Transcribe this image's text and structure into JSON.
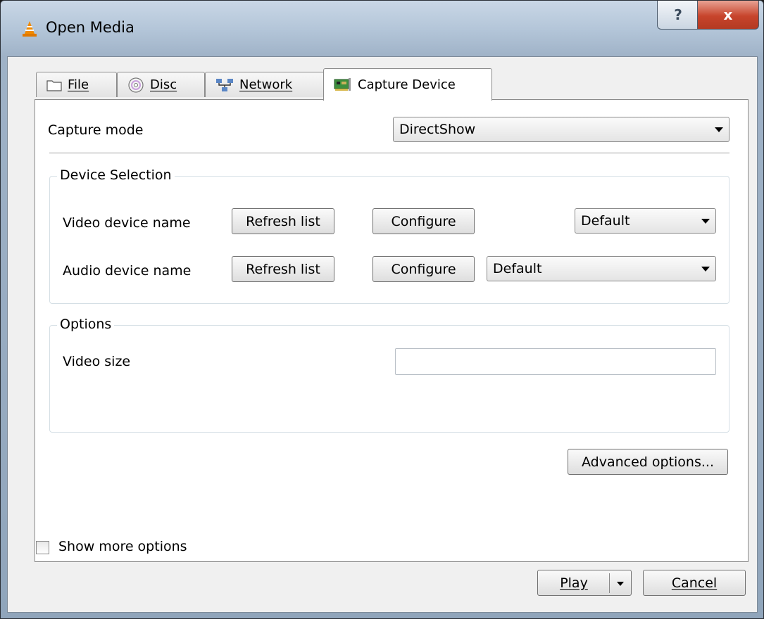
{
  "window": {
    "title": "Open Media",
    "help_label": "?",
    "close_label": "x"
  },
  "tabs": [
    {
      "label": "File",
      "icon": "folder-icon"
    },
    {
      "label": "Disc",
      "icon": "disc-icon"
    },
    {
      "label": "Network",
      "icon": "network-icon"
    },
    {
      "label": "Capture Device",
      "icon": "capture-card-icon",
      "active": true
    }
  ],
  "capture": {
    "mode_label": "Capture mode",
    "mode_value": "DirectShow",
    "device_group_title": "Device Selection",
    "video_label": "Video device name",
    "audio_label": "Audio device name",
    "refresh_label": "Refresh list",
    "configure_label": "Configure",
    "video_device_value": "Default",
    "audio_device_value": "Default",
    "options_group_title": "Options",
    "video_size_label": "Video size",
    "video_size_value": "",
    "advanced_label": "Advanced options..."
  },
  "footer": {
    "show_more_label": "Show more options",
    "show_more_checked": false,
    "play_label": "Play",
    "cancel_label": "Cancel"
  }
}
